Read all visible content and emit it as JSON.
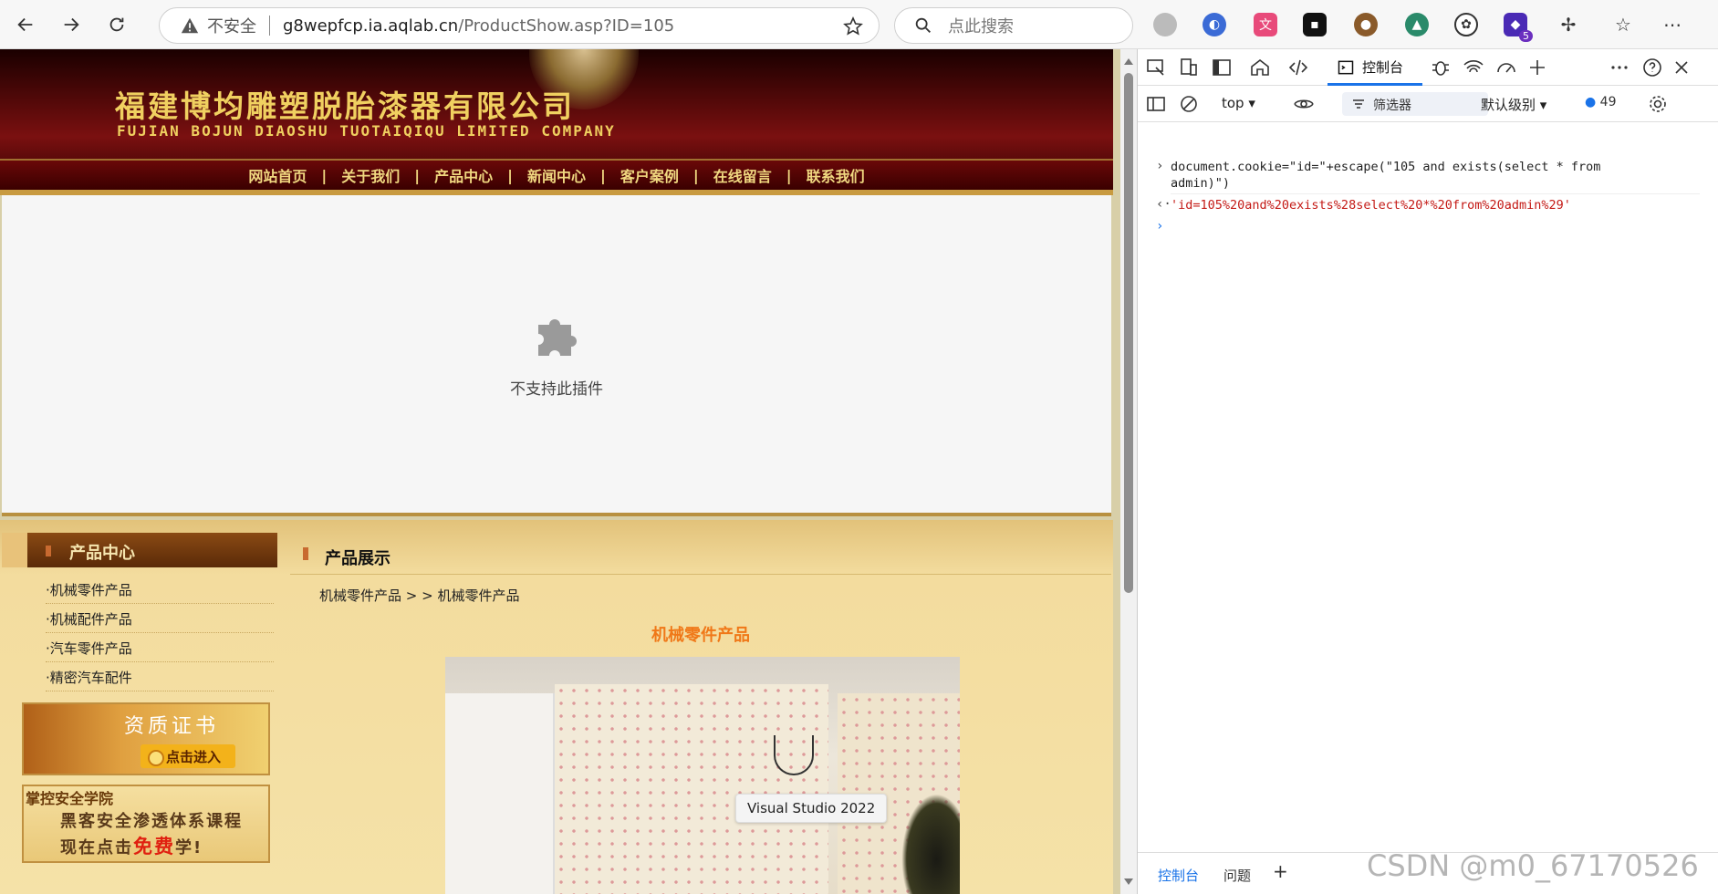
{
  "browser": {
    "insecure_label": "不安全",
    "url_host": "g8wepfcp.ia.aqlab.cn",
    "url_path": "/ProductShow.asp?ID=105",
    "search_placeholder": "点此搜索",
    "extension_badge": "5"
  },
  "site": {
    "company_cn": "福建博均雕塑脱胎漆器有限公司",
    "company_en": "FUJIAN BOJUN DIAOSHU  TUOTAIQIQU  LIMITED COMPANY",
    "nav": [
      "网站首页",
      "关于我们",
      "产品中心",
      "新闻中心",
      "客户案例",
      "在线留言",
      "联系我们"
    ],
    "nav_separator": "|",
    "plugin_message": "不支持此插件",
    "sidebar": {
      "title": "产品中心",
      "items": [
        "·机械零件产品",
        "·机械配件产品",
        "·汽车零件产品",
        "·精密汽车配件"
      ],
      "cert_title": "资质证书",
      "cert_button": "点击进入",
      "promo_title": "掌控安全学院",
      "promo_line1": "黑客安全渗透体系课程",
      "promo_line2_pre": "现在点击",
      "promo_line2_free": "免费",
      "promo_line2_post": "学!"
    },
    "content": {
      "section_title": "产品展示",
      "breadcrumb": "机械零件产品 > > 机械零件产品",
      "product_title": "机械零件产品"
    },
    "tooltip": "Visual Studio 2022"
  },
  "devtools": {
    "tab_console": "控制台",
    "context": "top",
    "filter_placeholder": "筛选器",
    "level": "默认级别",
    "message_count": "49",
    "input_line1": "document.cookie=\"id=\"+escape(\"105 and exists(select * from",
    "input_line2": "admin)\")",
    "output": "'id=105%20and%20exists%28select%20*%20from%20admin%29'",
    "bottom_tabs": [
      "控制台",
      "问题"
    ]
  },
  "watermark": "CSDN @m0_67170526",
  "colors": {
    "accent_blue": "#1a73e8",
    "string_red": "#c41a16",
    "product_title_orange": "#f07818",
    "nav_gold": "#f0d880"
  }
}
